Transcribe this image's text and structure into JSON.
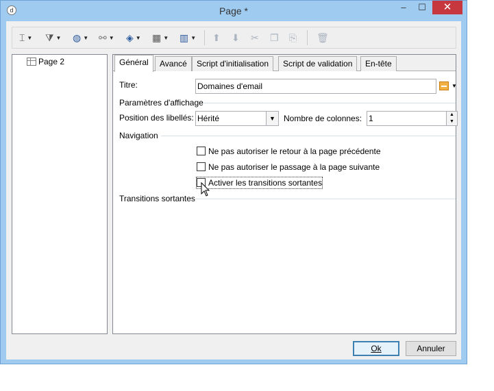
{
  "window": {
    "title": "Page *",
    "minimize_glyph": "–",
    "maximize_glyph": "☐",
    "close_glyph": "✕",
    "app_icon": "application-icon"
  },
  "toolbar": {
    "icons": [
      "insert-field-icon",
      "filter-icon",
      "globe-icon",
      "link-icon",
      "layers-icon",
      "table-icon",
      "columns-icon",
      "move-up-icon",
      "move-down-icon",
      "cut-icon",
      "copy-icon",
      "paste-icon",
      "delete-icon"
    ]
  },
  "tree": {
    "items": [
      {
        "label": "Page 2"
      }
    ]
  },
  "tabs": [
    {
      "label": "Général"
    },
    {
      "label": "Avancé"
    },
    {
      "label": "Script d'initialisation"
    },
    {
      "label": "Script de validation"
    },
    {
      "label": "En-tête"
    }
  ],
  "form": {
    "titre_label": "Titre:",
    "titre_value": "Domaines d'email",
    "affichage_group": "Paramètres d'affichage",
    "position_label": "Position des libellés:",
    "position_value": "Hérité",
    "colonnes_label": "Nombre de colonnes:",
    "colonnes_value": "1",
    "navigation_group": "Navigation",
    "checkboxes": [
      {
        "label": "Ne pas autoriser le retour à la page précédente",
        "checked": false
      },
      {
        "label": "Ne pas autoriser le passage à la page suivante",
        "checked": false
      },
      {
        "label": "Activer les transitions sortantes",
        "checked": false
      }
    ],
    "transitions_group": "Transitions sortantes"
  },
  "buttons": {
    "ok_label": "Ok",
    "cancel_label": "Annuler"
  },
  "colors": {
    "titlebar": "#9fcbf0",
    "close": "#c7383e",
    "toolbar_icon": "#2b5a9e"
  }
}
